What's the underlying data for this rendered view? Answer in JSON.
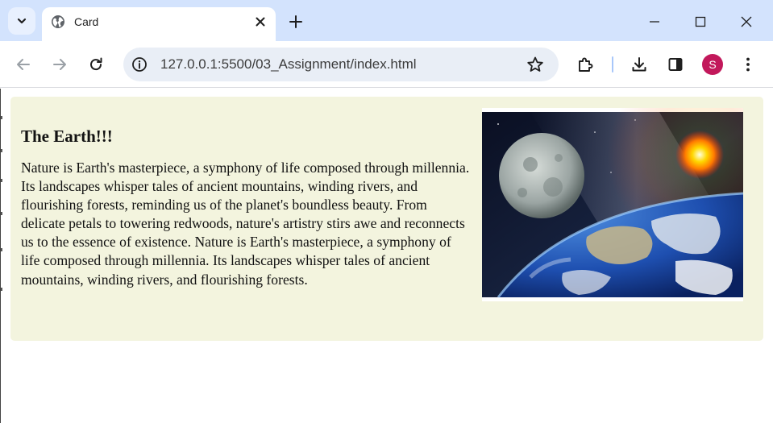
{
  "browser": {
    "tab": {
      "title": "Card",
      "icon": "globe-icon"
    },
    "address_bar": {
      "url": "127.0.0.1:5500/03_Assignment/index.html"
    },
    "profile": {
      "initial": "S",
      "color": "#c2185b"
    },
    "accent_color": "#d3e3fd"
  },
  "page": {
    "card": {
      "title": "The Earth!!!",
      "paragraph": "Nature is Earth's masterpiece, a symphony of life composed through millennia. Its landscapes whisper tales of ancient mountains, winding rivers, and flourishing forests, reminding us of the planet's boundless beauty. From delicate petals to towering redwoods, nature's artistry stirs awe and reconnects us to the essence of existence. Nature is Earth's masterpiece, a symphony of life composed through millennia. Its landscapes whisper tales of ancient mountains, winding rivers, and flourishing forests.",
      "background_color": "#f3f4de",
      "image_subject": "moon, sun and earth from space"
    }
  }
}
